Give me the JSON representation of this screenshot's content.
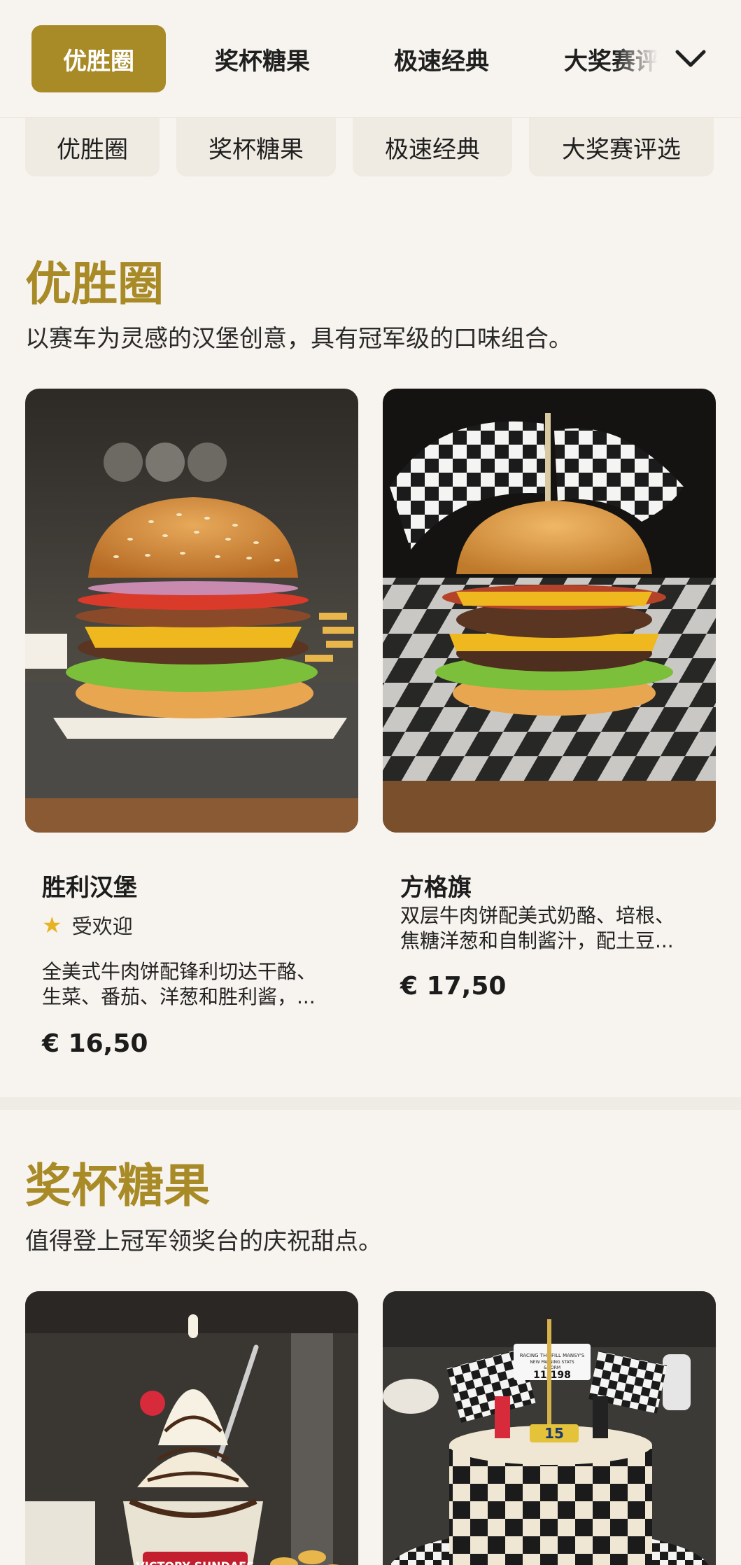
{
  "nav": {
    "tabs": [
      {
        "label": "优胜圈",
        "active": true
      },
      {
        "label": "奖杯糖果",
        "active": false
      },
      {
        "label": "极速经典",
        "active": false
      },
      {
        "label": "大奖赛评选",
        "active": false
      }
    ],
    "expand_icon": "chevron-down-icon"
  },
  "pills": [
    "优胜圈",
    "奖杯糖果",
    "极速经典",
    "大奖赛评选"
  ],
  "sections": [
    {
      "title": "优胜圈",
      "subtitle": "以赛车为灵感的汉堡创意，具有冠军级的口味组合。",
      "products": [
        {
          "name": "胜利汉堡",
          "badge": "受欢迎",
          "badge_icon": "star-icon",
          "desc_line1": "全美式牛肉饼配锋利切达干酪、",
          "desc_line2": "生菜、番茄、洋葱和胜利酱，...",
          "price": "€ 16,50"
        },
        {
          "name": "方格旗",
          "desc_line1": "双层牛肉饼配美式奶酪、培根、",
          "desc_line2": "焦糖洋葱和自制酱汁，配土豆...",
          "price": "€ 17,50"
        }
      ]
    },
    {
      "title": "奖杯糖果",
      "subtitle": "值得登上冠军领奖台的庆祝甜点。",
      "products": [
        {
          "image_text": "VICTORY SUNDAES"
        },
        {
          "image_text_1": "RACING THE FILL MANSY'S",
          "image_text_2": "NEW PANNING STATS",
          "image_text_3": "& FORM",
          "image_text_4": "11/198",
          "image_text_5": "15"
        }
      ]
    }
  ],
  "colors": {
    "accent": "#a88a26",
    "background": "#f7f4ef",
    "star": "#e6b422"
  }
}
